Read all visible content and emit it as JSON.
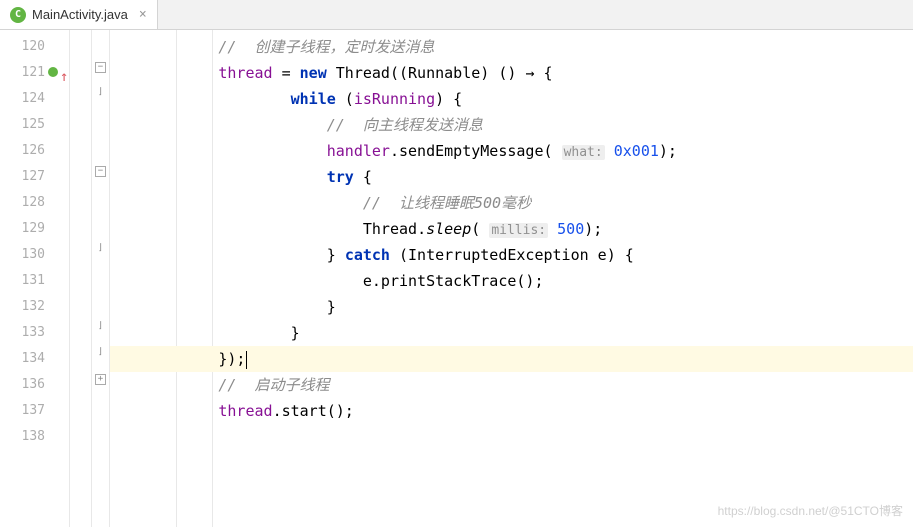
{
  "tab": {
    "icon_letter": "C",
    "filename": "MainActivity.java",
    "close": "×"
  },
  "line_numbers": [
    "120",
    "121",
    "124",
    "125",
    "126",
    "127",
    "128",
    "129",
    "130",
    "131",
    "132",
    "133",
    "134",
    "136",
    "137",
    "138"
  ],
  "code": {
    "l120": {
      "comment": "//  创建子线程，定时发送消息"
    },
    "l121": {
      "field": "thread",
      "eq": " = ",
      "kw_new": "new",
      "sp1": " ",
      "type": "Thread",
      "lp": "((",
      "cast": "Runnable",
      "rp": ") () ",
      "arrow": "→",
      "brace": " {"
    },
    "l124": {
      "kw_while": "while",
      "sp": " (",
      "field": "isRunning",
      "close": ") {"
    },
    "l125": {
      "comment": "//  向主线程发送消息"
    },
    "l126": {
      "field": "handler",
      "dot": ".",
      "method": "sendEmptyMessage",
      "lp": "( ",
      "hint": "what:",
      "sp": " ",
      "num": "0x001",
      "close": ");"
    },
    "l127": {
      "kw_try": "try",
      "brace": " {"
    },
    "l128": {
      "comment": "//  让线程睡眠500毫秒"
    },
    "l129": {
      "type": "Thread",
      "dot": ".",
      "method": "sleep",
      "lp": "( ",
      "hint": "millis:",
      "sp": " ",
      "num": "500",
      "close": ");"
    },
    "l130": {
      "brace": "} ",
      "kw_catch": "catch",
      "sp": " (",
      "type": "InterruptedException e",
      "close": ") {"
    },
    "l131": {
      "stmt": "e.printStackTrace();"
    },
    "l132": {
      "brace": "}"
    },
    "l133": {
      "brace": "}"
    },
    "l134": {
      "close": "});"
    },
    "l136": {
      "comment": "//  启动子线程"
    },
    "l137": {
      "field": "thread",
      "dot": ".",
      "method": "start",
      "close": "();"
    }
  },
  "fold": {
    "minus": "−",
    "plus": "+",
    "bracket": "⌋"
  },
  "watermark": "https://blog.csdn.net/@51CTO博客"
}
